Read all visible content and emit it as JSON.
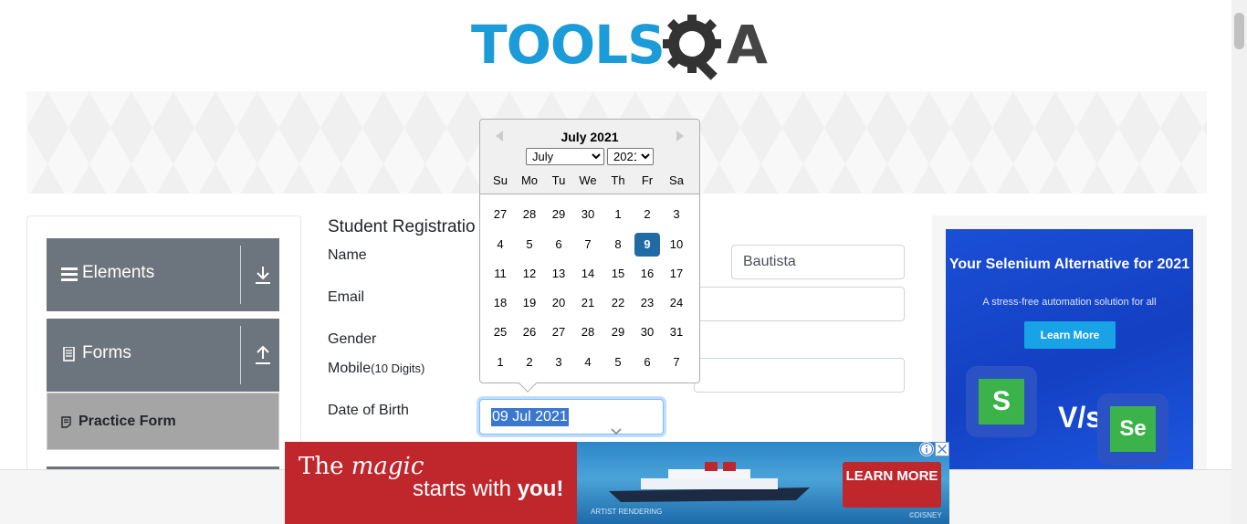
{
  "logo": {
    "text": "TOOLS",
    "suffix": "A"
  },
  "banner": {
    "title": "Practice Form",
    "visible_title": "rm"
  },
  "sidebar": {
    "groups": [
      {
        "label": "Elements",
        "icon": "hamburger-icon",
        "arrow": "download-arrow-icon"
      },
      {
        "label": "Forms",
        "icon": "document-icon",
        "arrow": "upload-arrow-icon"
      }
    ],
    "active_item": {
      "label": "Practice Form",
      "icon": "form-icon"
    }
  },
  "form": {
    "title": "Student Registratio",
    "labels": {
      "name": "Name",
      "email": "Email",
      "gender": "Gender",
      "mobile": "Mobile",
      "mobile_hint": "(10 Digits)",
      "dob": "Date of Birth"
    },
    "last_name_value": "Bautista",
    "dob_value": "09 Jul 2021"
  },
  "datepicker": {
    "header": "July 2021",
    "month_selected": "July",
    "year_selected": "2021",
    "weekdays": [
      "Su",
      "Mo",
      "Tu",
      "We",
      "Th",
      "Fr",
      "Sa"
    ],
    "weeks": [
      [
        "27",
        "28",
        "29",
        "30",
        "1",
        "2",
        "3"
      ],
      [
        "4",
        "5",
        "6",
        "7",
        "8",
        "9",
        "10"
      ],
      [
        "11",
        "12",
        "13",
        "14",
        "15",
        "16",
        "17"
      ],
      [
        "18",
        "19",
        "20",
        "21",
        "22",
        "23",
        "24"
      ],
      [
        "25",
        "26",
        "27",
        "28",
        "29",
        "30",
        "31"
      ],
      [
        "1",
        "2",
        "3",
        "4",
        "5",
        "6",
        "7"
      ]
    ],
    "selected_day": "9",
    "selected_color": "#216ba5"
  },
  "ad_right": {
    "title": "Your Selenium Alternative for 2021",
    "subtitle": "A stress-free automation solution for all",
    "button": "Learn More",
    "vs": "V/s",
    "tile_left": "S",
    "tile_right": "Se"
  },
  "ad_bottom": {
    "line1_a": "The ",
    "line1_b": "magic",
    "line2_a": "starts with ",
    "line2_b": "you!",
    "button": "LEARN MORE",
    "rendering": "ARTIST RENDERING",
    "brand": "©DISNEY"
  },
  "colors": {
    "accent": "#1b9bd7",
    "sidebar": "#6c757d",
    "ad_red": "#c0272d"
  }
}
